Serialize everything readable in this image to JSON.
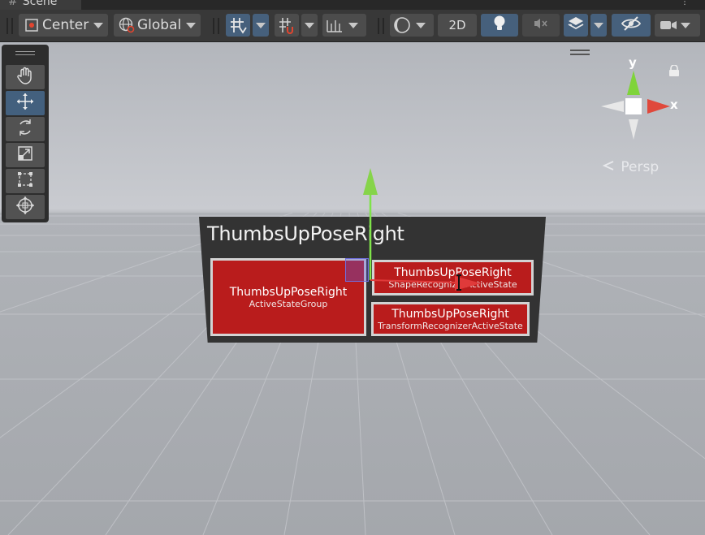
{
  "tab": {
    "title": "Scene"
  },
  "toolbar": {
    "pivot_label": "Center",
    "space_label": "Global",
    "mode_2d_label": "2D",
    "icons": [
      "rect-tool-icon",
      "globe-icon",
      "grid-snap-icon",
      "increment-snap-icon",
      "ruler-icon",
      "shading-sphere-icon",
      "lightbulb-icon",
      "mute-icon",
      "layers-icon",
      "hidden-eye-icon",
      "camera-icon"
    ]
  },
  "tools": [
    "hand-icon",
    "move-icon",
    "rotate-icon",
    "scale-icon",
    "rect-icon",
    "transform-icon"
  ],
  "gizmo": {
    "y_label": "y",
    "x_label": "x",
    "projection_label": "Persp"
  },
  "board": {
    "title": "ThumbsUpPoseRight",
    "cards": [
      {
        "title": "ThumbsUpPoseRight",
        "subtitle": "ActiveStateGroup"
      },
      {
        "title": "ThumbsUpPoseRight",
        "subtitle": "ShapeRecognizerActiveState"
      },
      {
        "title": "ThumbsUpPoseRight",
        "subtitle": "TransformRecognizerActiveState"
      }
    ]
  },
  "colors": {
    "card_red": "#b91c1c",
    "gizmo_y": "#7fd43a",
    "gizmo_x": "#e0483b",
    "active_tool": "#43607e"
  }
}
